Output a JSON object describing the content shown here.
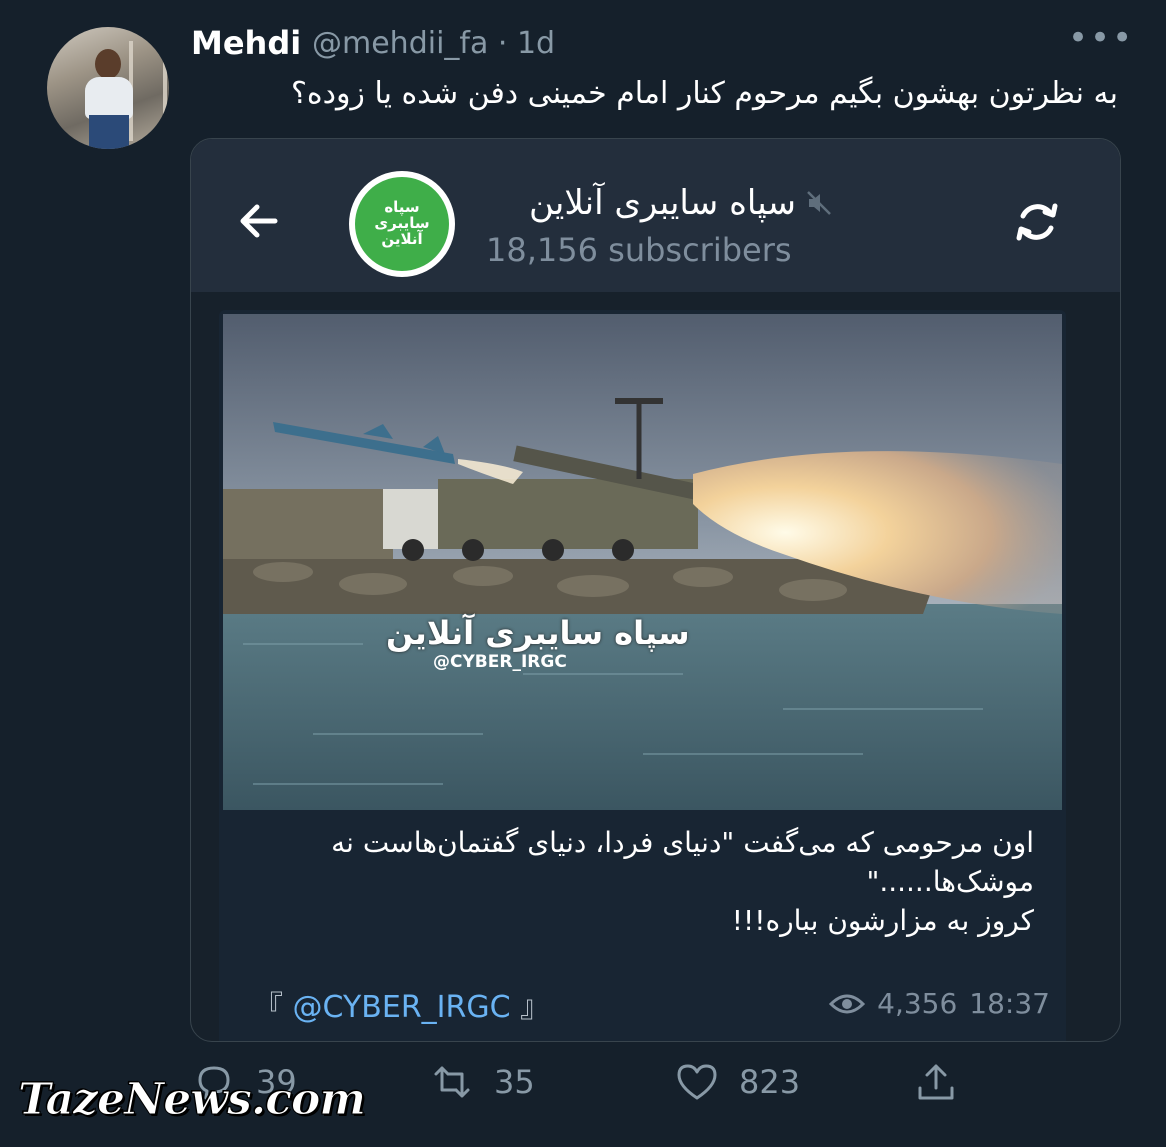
{
  "tweet": {
    "author_name": "Mehdi",
    "handle": "@mehdii_fa · 1d",
    "more_label": "•••",
    "text": "به نظرتون بهشون بگیم مرحوم کنار امام خمینی دفن شده یا زوده؟"
  },
  "telegram": {
    "channel_title": "سپاه سایبری آنلاین",
    "subscribers": "18,156 subscribers",
    "logo_lines": [
      "سپاه",
      "سایبری",
      "آنلاین"
    ],
    "photo_watermark": "سپاه سایبری آنلاین",
    "photo_handle": "@CYBER_IRGC",
    "caption_lines": [
      "اون مرحومی که می‌گفت \"دنیای فردا، دنیای گفتمان‌هاست نه",
      "موشک‌ها......\"",
      "کروز به مزارشون بباره!!!"
    ],
    "signature_open": "『",
    "signature": "@CYBER_IRGC",
    "signature_close": "』",
    "views": "4,356",
    "time": "18:37"
  },
  "actions": {
    "replies": "39",
    "retweets": "35",
    "likes": "823"
  },
  "watermark": "TazeNews.com",
  "colors": {
    "background": "#15202b",
    "secondary_text": "#8899a6",
    "telegram_header": "#232e3c",
    "telegram_link": "#6ab3f3",
    "channel_logo_green": "#3fae49"
  }
}
